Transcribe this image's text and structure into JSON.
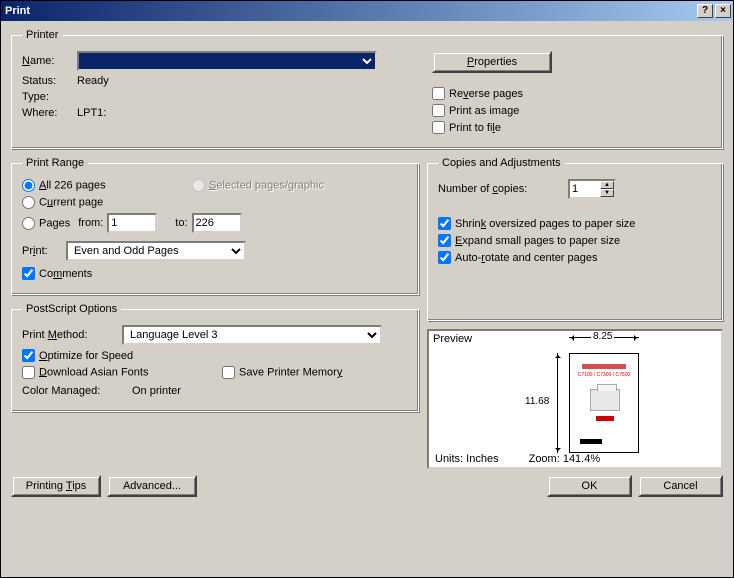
{
  "window": {
    "title": "Print"
  },
  "printer": {
    "legend": "Printer",
    "name_label": "Name:",
    "name_value": "",
    "properties_btn": "Properties",
    "status_label": "Status:",
    "status_value": "Ready",
    "type_label": "Type:",
    "type_value": "",
    "where_label": "Where:",
    "where_value": "LPT1:",
    "reverse_pages": "Reverse pages",
    "print_as_image": "Print as image",
    "print_to_file": "Print to file"
  },
  "range": {
    "legend": "Print Range",
    "all_pages": "All 226 pages",
    "selected": "Selected pages/graphic",
    "current_page": "Current page",
    "pages": "Pages",
    "from": "from:",
    "from_value": "1",
    "to": "to:",
    "to_value": "226",
    "print_label": "Print:",
    "print_mode": "Even and Odd Pages",
    "comments": "Comments"
  },
  "copies": {
    "legend": "Copies and Adjustments",
    "num_label": "Number of copies:",
    "num_value": "1",
    "shrink": "Shrink oversized pages to paper size",
    "expand": "Expand small pages to paper size",
    "autorotate": "Auto-rotate and center pages"
  },
  "postscript": {
    "legend": "PostScript Options",
    "method_label": "Print Method:",
    "method_value": "Language Level 3",
    "optimize": "Optimize for Speed",
    "download_asian": "Download Asian Fonts",
    "save_mem": "Save Printer Memory",
    "color_managed_label": "Color Managed:",
    "color_managed_value": "On printer"
  },
  "preview": {
    "label": "Preview",
    "width": "8.25",
    "height": "11.68",
    "units": "Units: Inches",
    "zoom": "Zoom: 141.4%"
  },
  "buttons": {
    "printing_tips": "Printing Tips",
    "advanced": "Advanced...",
    "ok": "OK",
    "cancel": "Cancel"
  }
}
